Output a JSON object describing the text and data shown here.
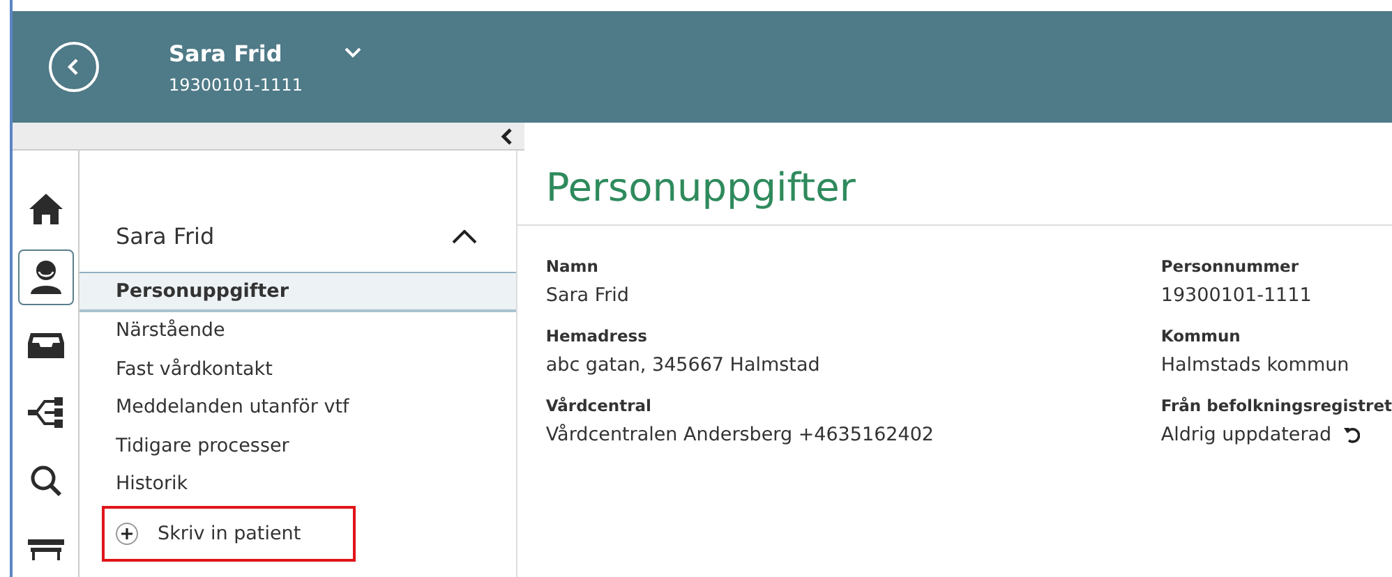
{
  "header": {
    "name": "Sara Frid",
    "personal_number": "19300101-1111"
  },
  "rail": [
    {
      "selected": false
    },
    {
      "selected": true
    },
    {
      "selected": false
    },
    {
      "selected": false
    },
    {
      "selected": false
    },
    {
      "selected": false
    }
  ],
  "nav": {
    "title": "Sara Frid",
    "expanded": true,
    "items": [
      {
        "label": "Personuppgifter",
        "kind": "link",
        "selected": true,
        "highlighted": false
      },
      {
        "label": "Närstående",
        "kind": "link",
        "selected": false,
        "highlighted": false
      },
      {
        "label": "Fast vårdkontakt",
        "kind": "link",
        "selected": false,
        "highlighted": false
      },
      {
        "label": "Meddelanden utanför vtf",
        "kind": "link",
        "selected": false,
        "highlighted": false
      },
      {
        "label": "Tidigare processer",
        "kind": "link",
        "selected": false,
        "highlighted": false
      },
      {
        "label": "Historik",
        "kind": "link",
        "selected": false,
        "highlighted": false
      },
      {
        "label": "Skriv in patient",
        "kind": "action",
        "selected": false,
        "highlighted": true
      }
    ]
  },
  "content": {
    "title": "Personuppgifter",
    "fields": [
      {
        "label": "Namn",
        "value": "Sara Frid"
      },
      {
        "label": "Personnummer",
        "value": "19300101-1111"
      },
      {
        "label": "Hemadress",
        "value": "abc gatan, 345667 Halmstad"
      },
      {
        "label": "Kommun",
        "value": "Halmstads kommun"
      },
      {
        "label": "Vårdcentral",
        "value": "Vårdcentralen Andersberg +4635162402"
      },
      {
        "label": "Från befolkningsregistret",
        "value": "Aldrig uppdaterad",
        "kind": "refresh"
      }
    ]
  }
}
